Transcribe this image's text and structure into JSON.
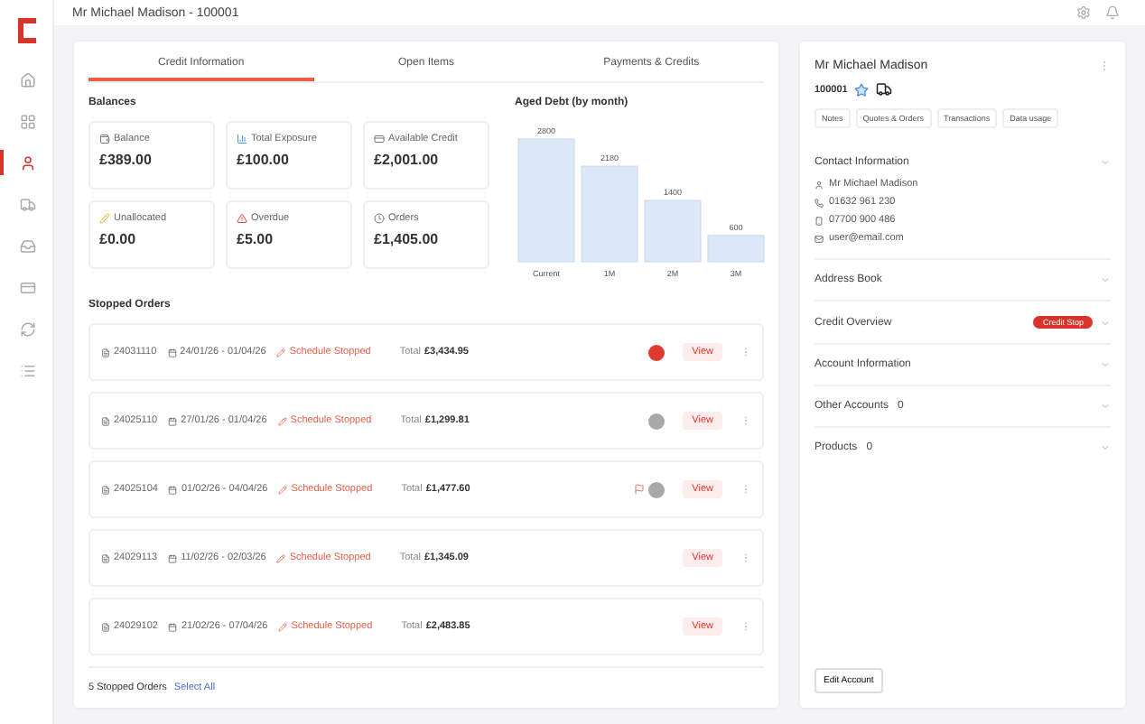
{
  "header": {
    "title": "Mr Michael Madison - 100001"
  },
  "nav": [
    {
      "selected": false
    },
    {
      "selected": false
    },
    {
      "selected": true
    },
    {
      "selected": false
    },
    {
      "selected": false
    },
    {
      "selected": false
    },
    {
      "selected": false
    },
    {
      "selected": false
    }
  ],
  "tabs": [
    {
      "label": "Credit Information",
      "selected": true
    },
    {
      "label": "Open Items",
      "selected": false
    },
    {
      "label": "Payments & Credits",
      "selected": false
    }
  ],
  "balances": {
    "title": "Balances",
    "cards": [
      {
        "label": "Balance",
        "value": "£389.00"
      },
      {
        "label": "Total Exposure",
        "value": "£100.00"
      },
      {
        "label": "Available Credit",
        "value": "£2,001.00"
      },
      {
        "label": "Unallocated",
        "value": "£0.00"
      },
      {
        "label": "Overdue",
        "value": "£5.00"
      },
      {
        "label": "Orders",
        "value": "£1,405.00"
      }
    ]
  },
  "aged_debt": {
    "title": "Aged Debt (by month)",
    "chart_data": {
      "type": "bar",
      "categories": [
        "Current",
        "1M",
        "2M",
        "3M"
      ],
      "values": [
        2800,
        2180,
        1400,
        600
      ],
      "data_labels": true
    }
  },
  "stopped_orders": {
    "title": "Stopped Orders",
    "rows": [
      {
        "order": "24031110",
        "dates": "24/01/26 - 01/04/26",
        "reason": "Schedule Stopped",
        "total_label": "Total",
        "total": "£3,434.95",
        "kind": "alert",
        "action": "View"
      },
      {
        "order": "24025110",
        "dates": "27/01/26 - 01/04/26",
        "reason": "Schedule Stopped",
        "total_label": "Total",
        "total": "£1,299.81",
        "kind": "pending",
        "action": "View"
      },
      {
        "order": "24025104",
        "dates": "01/02/26 - 04/04/26",
        "reason": "Schedule Stopped",
        "total_label": "Total",
        "total": "£1,477.60",
        "kind": "flagged",
        "action": "View"
      },
      {
        "order": "24029113",
        "dates": "11/02/26 - 02/03/26",
        "reason": "Schedule Stopped",
        "total_label": "Total",
        "total": "£1,345.09",
        "kind": "plain",
        "action": "View"
      },
      {
        "order": "24029102",
        "dates": "21/02/26 - 07/04/26",
        "reason": "Schedule Stopped",
        "total_label": "Total",
        "total": "£2,483.85",
        "kind": "plain",
        "action": "View"
      }
    ],
    "footer_count": "5 Stopped Orders",
    "footer_link": "Select All"
  },
  "customer": {
    "name": "Mr Michael Madison",
    "account": "100001",
    "tabs": [
      {
        "label": "Notes",
        "selected": false
      },
      {
        "label": "Quotes & Orders",
        "selected": false
      },
      {
        "label": "Transactions",
        "selected": false
      },
      {
        "label": "Data usage",
        "selected": false
      }
    ],
    "contact": {
      "title": "Contact Information",
      "lines": [
        "Mr Michael Madison",
        "01632 961 230",
        "07700 900 486",
        "user@email.com"
      ]
    },
    "sections": [
      {
        "title": "Address Book"
      },
      {
        "title": "Credit Overview",
        "badge": "Credit Stop"
      },
      {
        "title": "Account Information"
      },
      {
        "title": "Other Accounts",
        "count": "0"
      },
      {
        "title": "Products",
        "count": "0"
      }
    ],
    "edit_button": "Edit Account"
  }
}
